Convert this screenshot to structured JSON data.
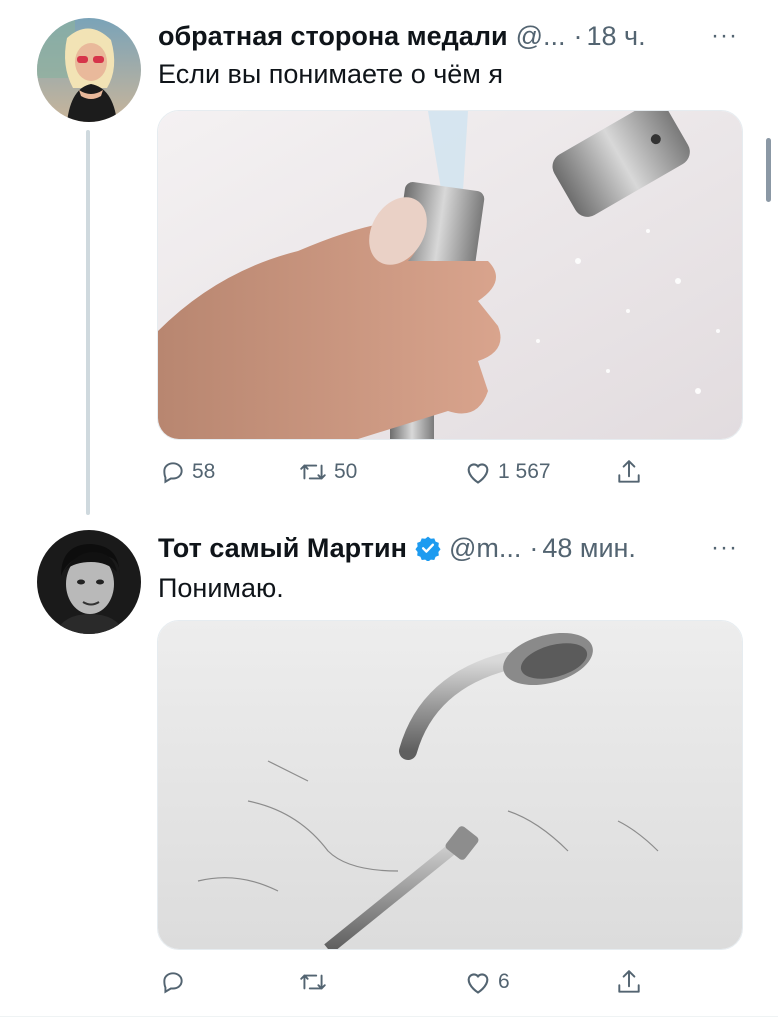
{
  "tweets": [
    {
      "name": "обратная сторона медали",
      "handle": "@...",
      "dot": "·",
      "time": "18 ч.",
      "more": "···",
      "text": "Если вы понимаете о чём я",
      "replies": "58",
      "retweets": "50",
      "likes": "1 567"
    },
    {
      "name": "Тот самый Мартин",
      "verified": true,
      "handle": "@m...",
      "dot": "·",
      "time": "48 мин.",
      "more": "···",
      "text": "Понимаю.",
      "replies": "",
      "retweets": "",
      "likes": "6"
    }
  ],
  "icons": {
    "reply": "reply-icon",
    "retweet": "retweet-icon",
    "like": "like-icon",
    "share": "share-icon",
    "verified": "verified-badge-icon"
  },
  "colors": {
    "text_primary": "#0f1419",
    "text_secondary": "#536471",
    "verified_blue": "#1d9bf0",
    "thread_line": "#cfd9de"
  }
}
